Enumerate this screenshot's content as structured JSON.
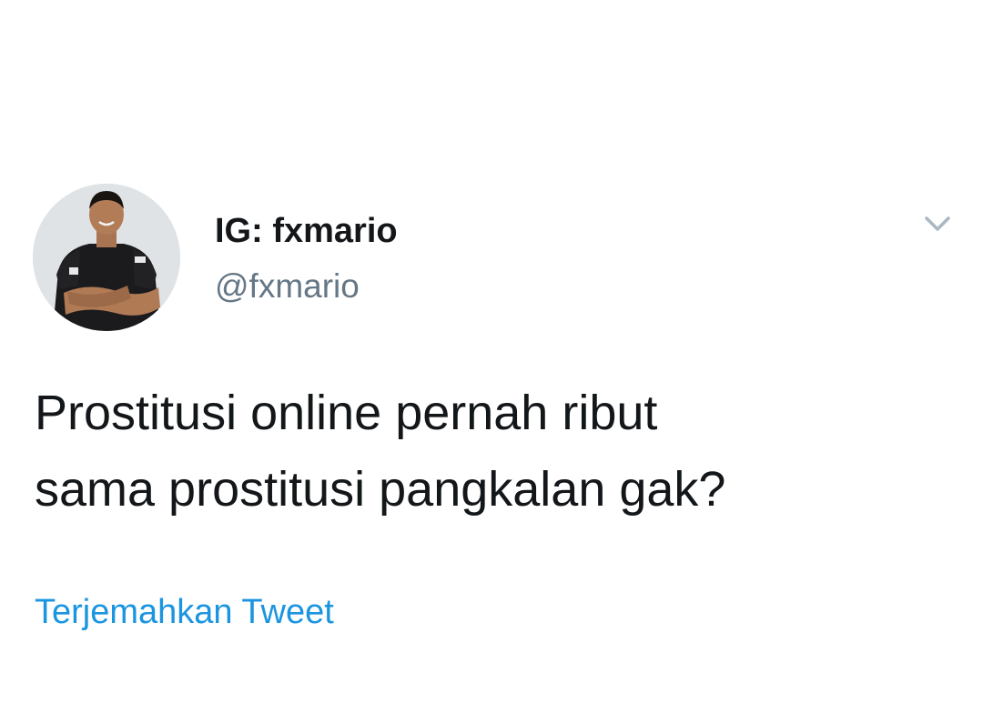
{
  "tweet": {
    "author": {
      "display_name": "IG: fxmario",
      "handle": "@fxmario",
      "avatar": "profile-photo"
    },
    "menu_icon": "chevron-down-icon",
    "text_lines": [
      "Prostitusi online pernah ribut",
      "sama prostitusi pangkalan gak?"
    ],
    "translate_label": "Terjemahkan Tweet"
  },
  "colors": {
    "text_primary": "#14171a",
    "text_secondary": "#657786",
    "link": "#1b95e0",
    "caret": "#aab8c2",
    "background": "#ffffff"
  }
}
